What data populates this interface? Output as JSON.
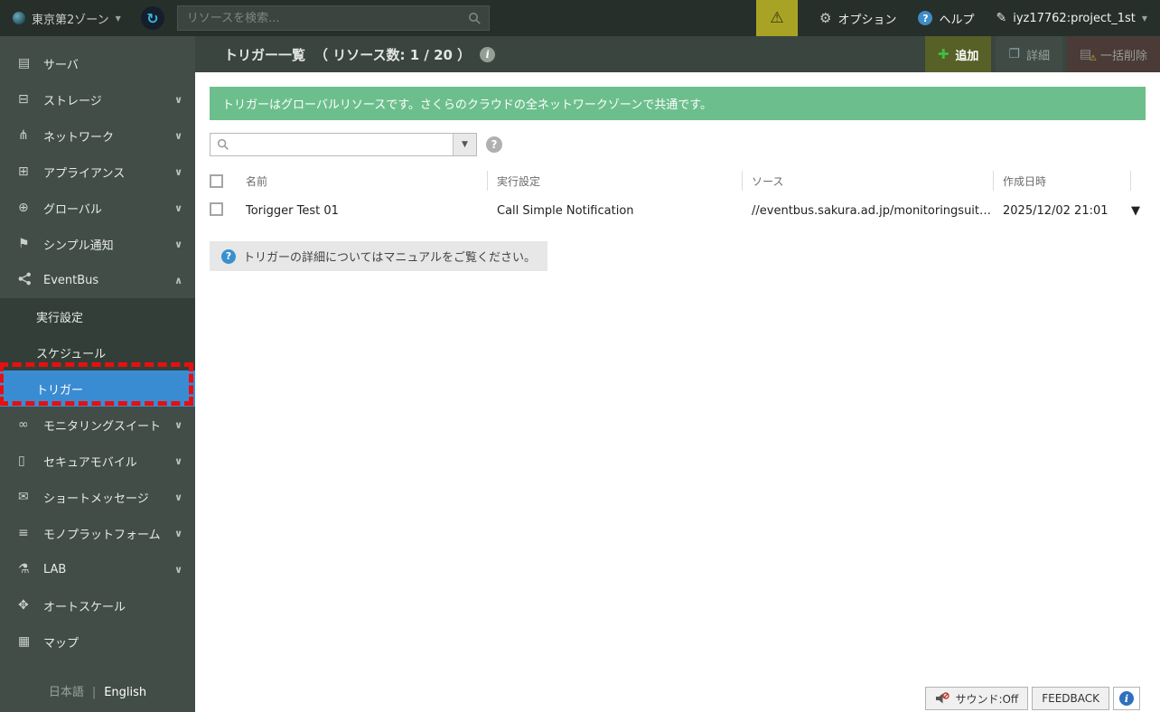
{
  "topbar": {
    "zone": "東京第2ゾーン",
    "search_placeholder": "リソースを検索...",
    "options": "オプション",
    "help": "ヘルプ",
    "account": "iyz17762:project_1st"
  },
  "sidebar": {
    "items": [
      {
        "label": "サーバ"
      },
      {
        "label": "ストレージ"
      },
      {
        "label": "ネットワーク"
      },
      {
        "label": "アプライアンス"
      },
      {
        "label": "グローバル"
      },
      {
        "label": "シンプル通知"
      },
      {
        "label": "EventBus"
      },
      {
        "label": "モニタリングスイート"
      },
      {
        "label": "セキュアモバイル"
      },
      {
        "label": "ショートメッセージ"
      },
      {
        "label": "モノプラットフォーム"
      },
      {
        "label": "LAB"
      },
      {
        "label": "オートスケール"
      },
      {
        "label": "マップ"
      }
    ],
    "eventbus_children": [
      {
        "label": "実行設定"
      },
      {
        "label": "スケジュール"
      },
      {
        "label": "トリガー",
        "selected": true
      }
    ],
    "language": {
      "ja": "日本語",
      "divider": "|",
      "en": "English"
    }
  },
  "header": {
    "title": "トリガー一覧",
    "count": "（ リソース数: 1 / 20 ）",
    "add": "追加",
    "detail": "詳細",
    "bulk_delete": "一括削除"
  },
  "main": {
    "banner": "トリガーはグローバルリソースです。さくらのクラウドの全ネットワークゾーンで共通です。",
    "table": {
      "col_name": "名前",
      "col_exec": "実行設定",
      "col_source": "ソース",
      "col_created": "作成日時",
      "row": {
        "name": "Torigger Test 01",
        "exec": "Call Simple Notification",
        "source": "//eventbus.sakura.ad.jp/monitoringsuit…",
        "created": "2025/12/02 21:01"
      }
    },
    "note": "トリガーの詳細についてはマニュアルをご覧ください。"
  },
  "statusbar": {
    "sound": "サウンド:Off",
    "feedback": "FEEDBACK"
  },
  "icons": {
    "zone_caret": "▼",
    "refresh": "↻",
    "warning": "⚠",
    "gear": "⚙",
    "help_q": "?",
    "pen": "✎",
    "account_caret": "▼",
    "server": "▤",
    "storage": "⊟",
    "network": "⋔",
    "appliance": "⊞",
    "global": "⊕",
    "notify": "⚑",
    "monitoring": "∞",
    "mobile": "▯",
    "message": "✉",
    "mono": "≡",
    "lab": "⚗",
    "autoscale": "✥",
    "map": "▦",
    "chev_down": "∨",
    "chev_up": "∧",
    "plus": "✚",
    "book": "❐",
    "del_server": "▤",
    "del_warn": "⚠",
    "title_info": "i",
    "filter_caret": "▼",
    "filter_help": "?",
    "note_q": "?",
    "row_caret": "▼",
    "status_info": "i"
  },
  "colors": {
    "accent_blue": "#3a8cd2",
    "banner_green": "#6cbf8c",
    "warning_olive": "#a9a325",
    "link_blue": "#4a90cf",
    "annotation_red": "#e80f0f",
    "add_button_olive": "#566027"
  }
}
